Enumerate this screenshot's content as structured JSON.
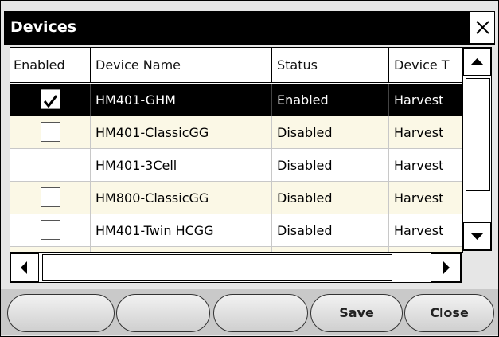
{
  "dialog": {
    "title": "Devices"
  },
  "grid": {
    "columns": [
      "Enabled",
      "Device Name",
      "Status",
      "Device T"
    ],
    "rows": [
      {
        "enabled": true,
        "name": "HM401-GHM",
        "status": "Enabled",
        "type": "Harvest"
      },
      {
        "enabled": false,
        "name": "HM401-ClassicGG",
        "status": "Disabled",
        "type": "Harvest"
      },
      {
        "enabled": false,
        "name": "HM401-3Cell",
        "status": "Disabled",
        "type": "Harvest"
      },
      {
        "enabled": false,
        "name": "HM800-ClassicGG",
        "status": "Disabled",
        "type": "Harvest"
      },
      {
        "enabled": false,
        "name": "HM401-Twin HCGG",
        "status": "Disabled",
        "type": "Harvest"
      }
    ]
  },
  "buttons": {
    "blank1": "",
    "blank2": "",
    "blank3": "",
    "save": "Save",
    "close": "Close"
  }
}
